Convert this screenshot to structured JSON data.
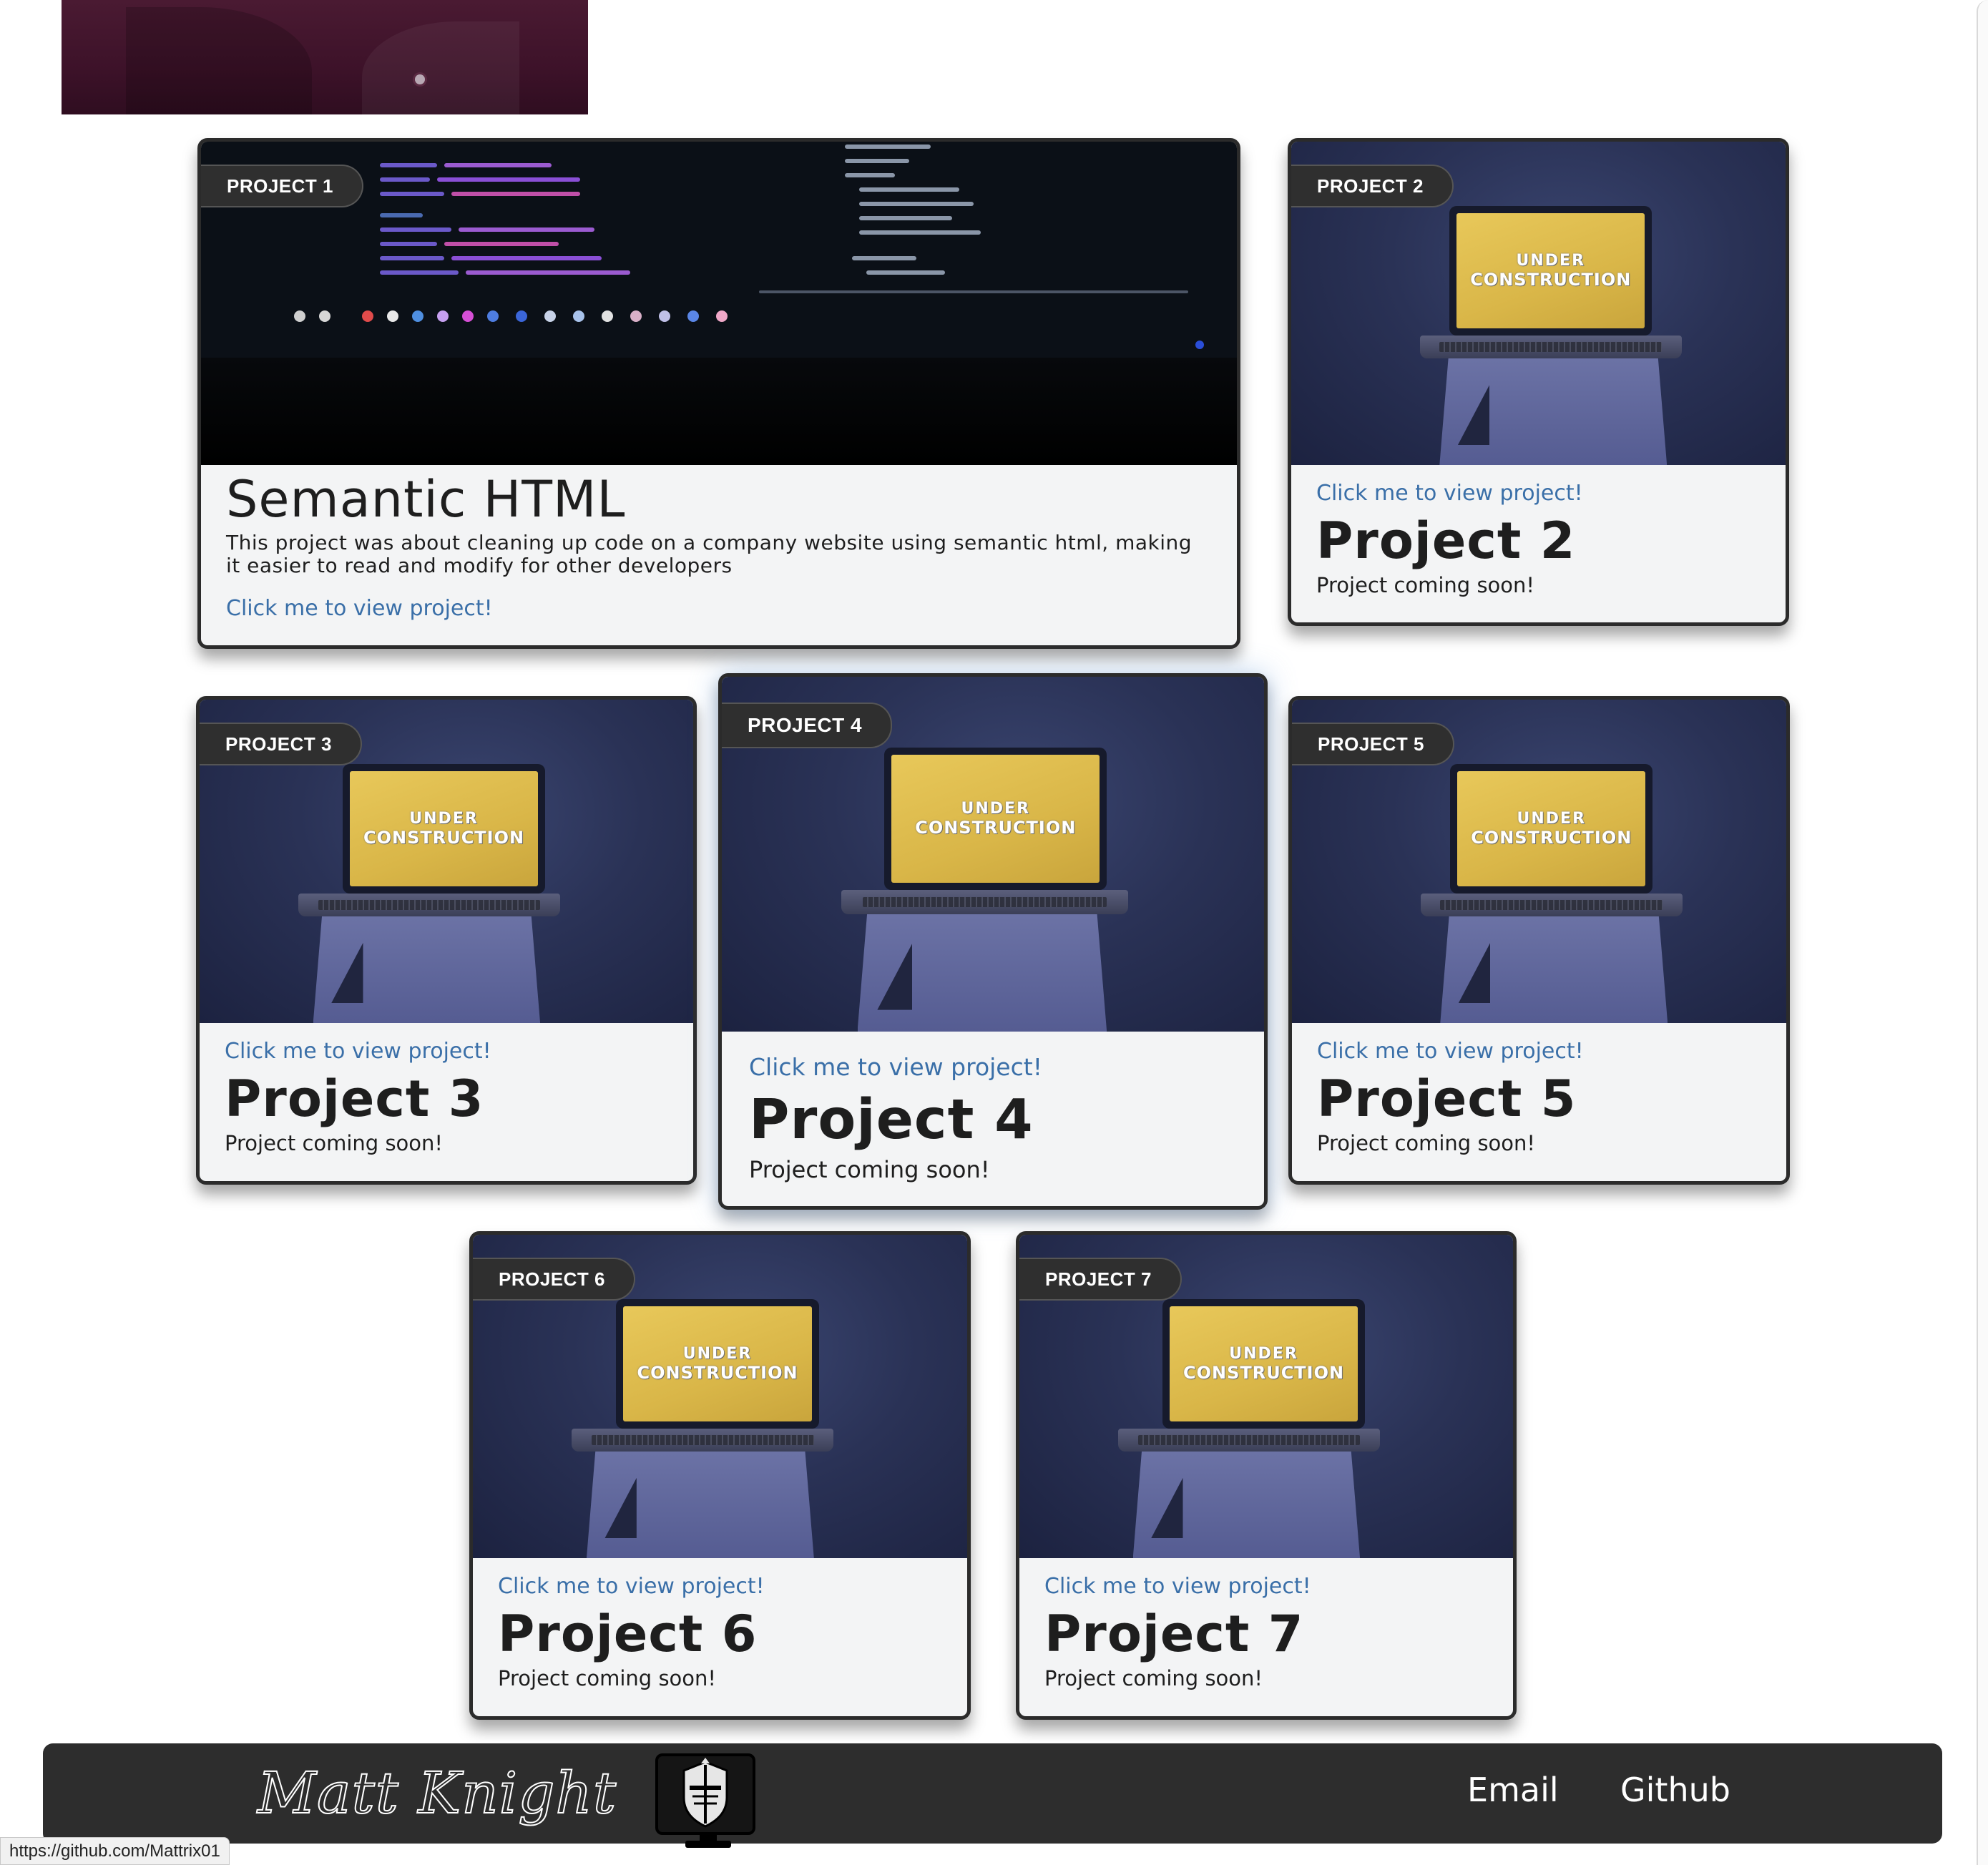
{
  "cards": [
    {
      "tag": "PROJECT 1",
      "link": "Click me to view project!",
      "title": "Semantic HTML",
      "desc": "This project was about cleaning up code on a company website using semantic html, making it easier to read and modify for other developers",
      "image": "code-editor-screen"
    },
    {
      "tag": "PROJECT 2",
      "link": "Click me to view project!",
      "title": "Project 2",
      "desc": "Project coming soon!",
      "image": "under-construction-laptop"
    },
    {
      "tag": "PROJECT 3",
      "link": "Click me to view project!",
      "title": "Project 3",
      "desc": "Project coming soon!",
      "image": "under-construction-laptop"
    },
    {
      "tag": "PROJECT 4",
      "link": "Click me to view project!",
      "title": "Project 4",
      "desc": "Project coming soon!",
      "image": "under-construction-laptop"
    },
    {
      "tag": "PROJECT 5",
      "link": "Click me to view project!",
      "title": "Project 5",
      "desc": "Project coming soon!",
      "image": "under-construction-laptop"
    },
    {
      "tag": "PROJECT 6",
      "link": "Click me to view project!",
      "title": "Project 6",
      "desc": "Project coming soon!",
      "image": "under-construction-laptop"
    },
    {
      "tag": "PROJECT 7",
      "link": "Click me to view project!",
      "title": "Project 7",
      "desc": "Project coming soon!",
      "image": "under-construction-laptop"
    }
  ],
  "screen_text": {
    "line1": "UNDER",
    "line2": "CONSTRUCTION"
  },
  "footer": {
    "brand": "Matt Knight",
    "logo_icon": "knight-helmet-monitor-icon",
    "nav": [
      {
        "label": "Email"
      },
      {
        "label": "Github"
      }
    ]
  },
  "status_bar": {
    "url": "https://github.com/Mattrix01"
  },
  "colors": {
    "link": "#3a6fa8",
    "card_border": "#2b2b2b",
    "card_body": "#f3f4f5",
    "footer_bg": "#2d2d2d",
    "tag_bg": "#2f2f2f"
  }
}
